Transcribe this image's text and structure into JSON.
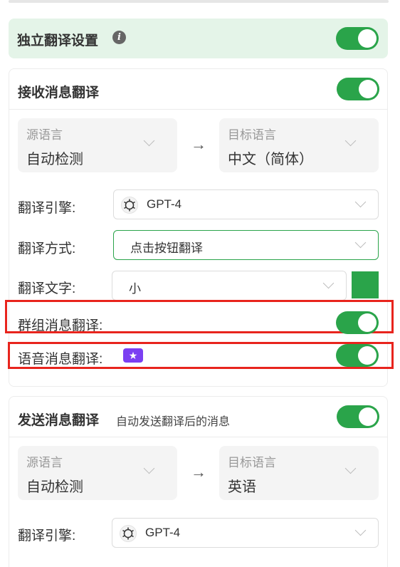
{
  "independent": {
    "title": "独立翻译设置",
    "info_icon": "info-icon",
    "toggle_on": true
  },
  "receive": {
    "title": "接收消息翻译",
    "toggle_on": true,
    "source": {
      "label": "源语言",
      "value": "自动检测"
    },
    "target": {
      "label": "目标语言",
      "value": "中文（简体）"
    },
    "arrow": "→",
    "engine": {
      "label": "翻译引擎:",
      "value": "GPT-4",
      "icon": "openai-icon"
    },
    "mode": {
      "label": "翻译方式:",
      "value": "点击按钮翻译"
    },
    "text_size": {
      "label": "翻译文字:",
      "value": "小"
    },
    "group": {
      "label": "群组消息翻译:",
      "toggle_on": true
    },
    "voice": {
      "label": "语音消息翻译:",
      "badge": "★",
      "badge_icon": "premium-star-icon",
      "toggle_on": true
    }
  },
  "send": {
    "title": "发送消息翻译",
    "subtitle": "自动发送翻译后的消息",
    "toggle_on": true,
    "source": {
      "label": "源语言",
      "value": "自动检测"
    },
    "target": {
      "label": "目标语言",
      "value": "英语"
    },
    "arrow": "→",
    "engine": {
      "label": "翻译引擎:",
      "value": "GPT-4",
      "icon": "openai-icon"
    }
  },
  "colors": {
    "accent": "#2aa44a",
    "highlight": "#e8241d",
    "badge": "#7b3ff2",
    "panel_green": "#e4f4e8"
  }
}
